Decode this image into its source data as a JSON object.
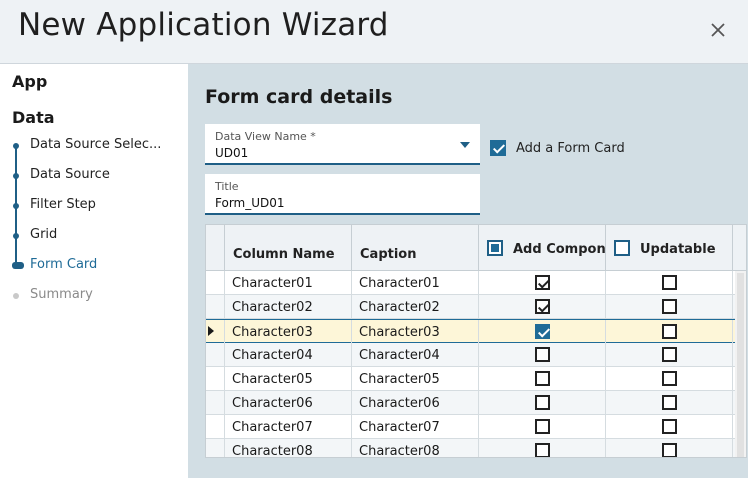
{
  "window": {
    "title": "New Application Wizard",
    "close_icon": "close-icon"
  },
  "sidebar": {
    "sections": [
      {
        "label": "App"
      },
      {
        "label": "Data"
      }
    ],
    "steps": [
      {
        "label": "Data Source Selec...",
        "state": "done"
      },
      {
        "label": "Data Source",
        "state": "done"
      },
      {
        "label": "Filter Step",
        "state": "done"
      },
      {
        "label": "Grid",
        "state": "done"
      },
      {
        "label": "Form Card",
        "state": "active"
      },
      {
        "label": "Summary",
        "state": "disabled"
      }
    ]
  },
  "main": {
    "heading": "Form card details",
    "data_view": {
      "label": "Data View Name *",
      "value": "UD01"
    },
    "add_form_card": {
      "label": "Add a Form Card",
      "checked": true
    },
    "title_field": {
      "label": "Title",
      "value": "Form_UD01"
    },
    "grid": {
      "columns": [
        "Column Name",
        "Caption",
        "Add Compon",
        "Updatable"
      ],
      "rows": [
        {
          "column_name": "Character01",
          "caption": "Character01",
          "add": true,
          "updatable": false
        },
        {
          "column_name": "Character02",
          "caption": "Character02",
          "add": true,
          "updatable": false
        },
        {
          "column_name": "Character03",
          "caption": "Character03",
          "add": true,
          "updatable": false,
          "selected": true
        },
        {
          "column_name": "Character04",
          "caption": "Character04",
          "add": false,
          "updatable": false
        },
        {
          "column_name": "Character05",
          "caption": "Character05",
          "add": false,
          "updatable": false
        },
        {
          "column_name": "Character06",
          "caption": "Character06",
          "add": false,
          "updatable": false
        },
        {
          "column_name": "Character07",
          "caption": "Character07",
          "add": false,
          "updatable": false
        },
        {
          "column_name": "Character08",
          "caption": "Character08",
          "add": false,
          "updatable": false
        }
      ]
    }
  },
  "colors": {
    "accent": "#1f6b97",
    "panel": "#d2dee4",
    "selected_row": "#fdf6d8"
  }
}
